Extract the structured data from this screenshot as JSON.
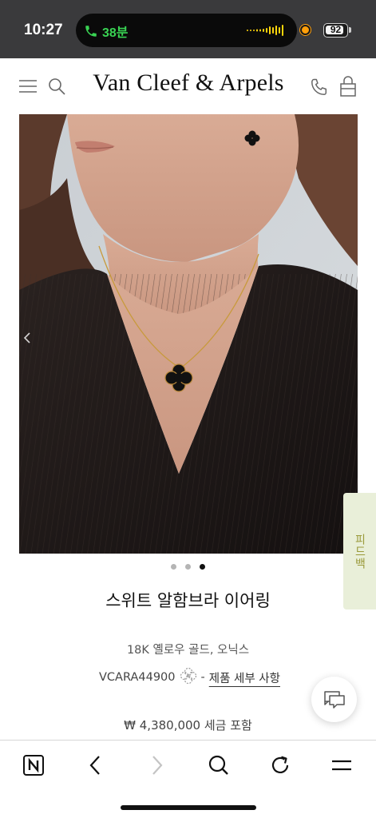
{
  "status_bar": {
    "time": "10:27",
    "call_duration": "38분",
    "battery_level": "92",
    "colors": {
      "call_green": "#39d353",
      "recording_dot": "#ff9f0a"
    }
  },
  "header": {
    "brand": "Van Cleef & Arpels",
    "icons": [
      "menu-icon",
      "search-icon",
      "phone-icon",
      "shopping-bag-icon"
    ]
  },
  "gallery": {
    "slide_count": 3,
    "active_slide": 3,
    "prev_icon": "chevron-left-icon",
    "image_subject": "model wearing black clover necklace and earring"
  },
  "feedback_tab": {
    "label": "피드백"
  },
  "product": {
    "name": "스위트 알함브라 이어링",
    "material": "18K 옐로우 골드, 오닉스",
    "reference": "VCARA44900",
    "separator": "-",
    "details_link": "제품 세부 사항",
    "price": "₩ 4,380,000 세금 포함"
  },
  "chat_button": {
    "icon": "chat-bubbles-icon"
  },
  "toolbar": {
    "buttons": [
      "naver-home-icon",
      "back-icon",
      "forward-icon",
      "search-icon",
      "reload-icon",
      "menu-icon"
    ],
    "forward_enabled": false
  }
}
